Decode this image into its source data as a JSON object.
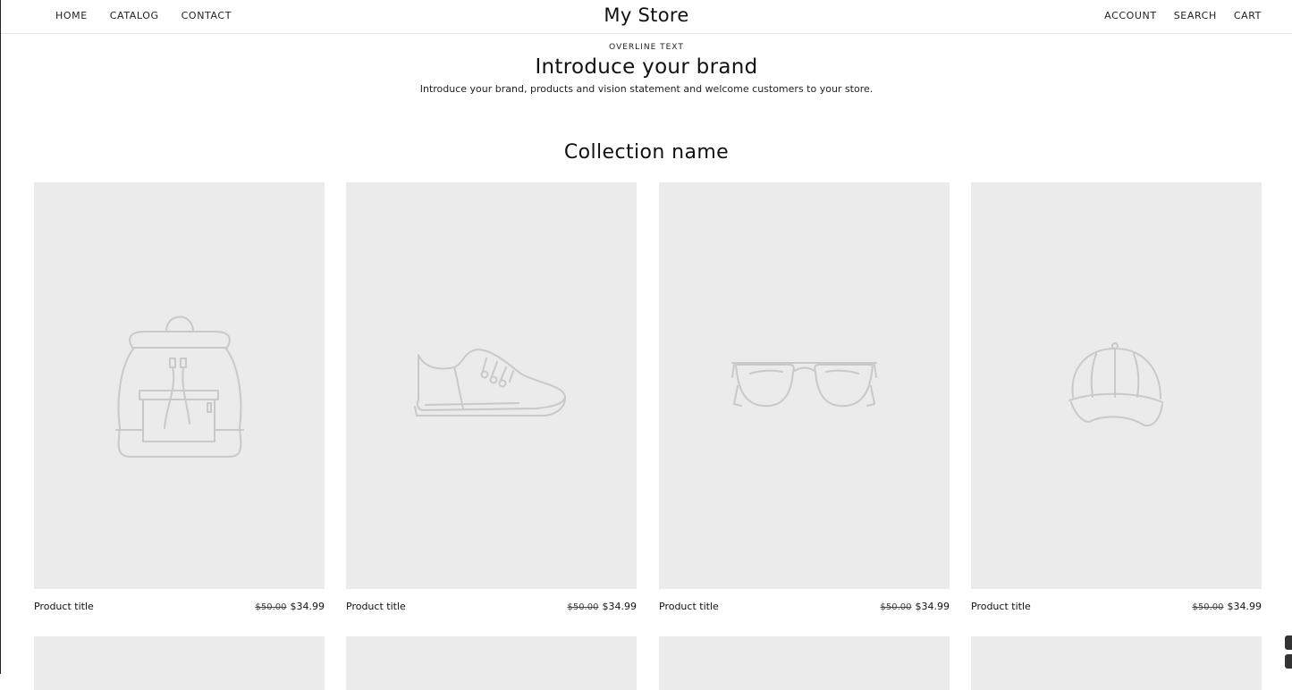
{
  "header": {
    "store_title": "My Store",
    "nav_left": [
      "HOME",
      "CATALOG",
      "CONTACT"
    ],
    "nav_right": [
      "ACCOUNT",
      "SEARCH",
      "CART"
    ]
  },
  "intro": {
    "overline": "OVERLINE TEXT",
    "heading": "Introduce your brand",
    "text": "Introduce your brand, products and vision statement and welcome customers to your store."
  },
  "collection": {
    "title": "Collection name",
    "products": [
      {
        "title": "Product title",
        "compare_price": "$50.00",
        "price": "$34.99",
        "image_icon": "backpack-icon"
      },
      {
        "title": "Product title",
        "compare_price": "$50.00",
        "price": "$34.99",
        "image_icon": "sneaker-icon"
      },
      {
        "title": "Product title",
        "compare_price": "$50.00",
        "price": "$34.99",
        "image_icon": "sunglasses-icon"
      },
      {
        "title": "Product title",
        "compare_price": "$50.00",
        "price": "$34.99",
        "image_icon": "cap-icon"
      }
    ]
  },
  "colors": {
    "placeholder_bg": "#ebebeb",
    "illustration_stroke": "#c9c9c9",
    "text": "#111111"
  }
}
